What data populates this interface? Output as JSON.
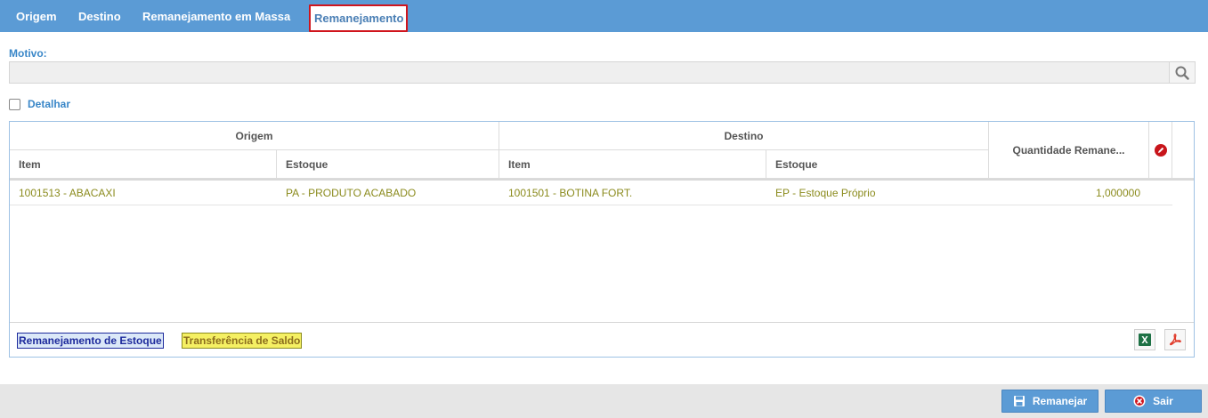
{
  "tabs": [
    {
      "label": "Origem"
    },
    {
      "label": "Destino"
    },
    {
      "label": "Remanejamento em Massa"
    },
    {
      "label": "Remanejamento"
    }
  ],
  "motivo": {
    "label": "Motivo:",
    "value": "",
    "placeholder": ""
  },
  "detalhar": {
    "label": "Detalhar",
    "checked": false
  },
  "grid": {
    "group_headers": {
      "origem": "Origem",
      "destino": "Destino"
    },
    "columns": {
      "origem_item": "Item",
      "origem_estoque": "Estoque",
      "destino_item": "Item",
      "destino_estoque": "Estoque",
      "quantidade": "Quantidade Remane..."
    },
    "rows": [
      {
        "origem_item": "1001513 - ABACAXI",
        "origem_estoque": "PA - PRODUTO ACABADO",
        "destino_item": "1001501 - BOTINA FORT.",
        "destino_estoque": "EP - Estoque Próprio",
        "quantidade": "1,000000"
      }
    ],
    "legend": {
      "remanejamento": "Remanejamento de Estoque",
      "transferencia": "Transferência de Saldo"
    }
  },
  "buttons": {
    "remanejar": "Remanejar",
    "sair": "Sair"
  },
  "icons": {
    "search": "search-icon",
    "edit": "pencil-icon",
    "excel": "excel-icon",
    "pdf": "pdf-icon",
    "save": "save-icon",
    "close": "close-circle-icon"
  },
  "colors": {
    "accent": "#5b9bd5",
    "row_text": "#8b8b1d",
    "active_tab_border": "#d0151d"
  }
}
